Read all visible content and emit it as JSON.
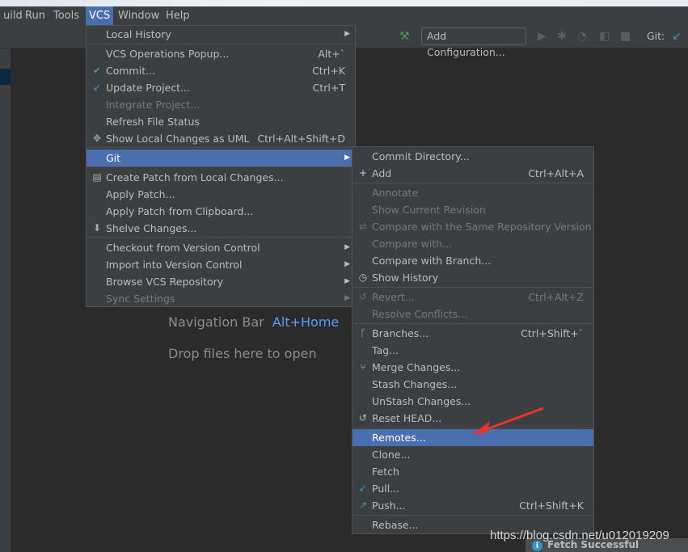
{
  "menubar": {
    "items": [
      "uild",
      "Run",
      "Tools",
      "VCS",
      "Window",
      "Help"
    ],
    "active": "VCS"
  },
  "toolbar": {
    "add_configuration": "Add Configuration...",
    "git_label": "Git:"
  },
  "editor_hints": {
    "navigation_bar": "Navigation Bar",
    "navigation_shortcut": "Alt+Home",
    "drop_files": "Drop files here to open"
  },
  "vcs_menu": [
    {
      "label": "Local History",
      "submenu": true
    },
    {
      "label": "VCS Operations Popup...",
      "shortcut": "Alt+`"
    },
    {
      "label": "Commit...",
      "shortcut": "Ctrl+K",
      "icon": "check-icon"
    },
    {
      "label": "Update Project...",
      "shortcut": "Ctrl+T",
      "icon": "update-arrow-icon"
    },
    {
      "label": "Integrate Project...",
      "disabled": true
    },
    {
      "label": "Refresh File Status"
    },
    {
      "label": "Show Local Changes as UML",
      "shortcut": "Ctrl+Alt+Shift+D",
      "icon": "uml-icon"
    },
    {
      "label": "Git",
      "submenu": true,
      "selected": true
    },
    {
      "label": "Create Patch from Local Changes...",
      "icon": "patch-icon"
    },
    {
      "label": "Apply Patch..."
    },
    {
      "label": "Apply Patch from Clipboard..."
    },
    {
      "label": "Shelve Changes...",
      "icon": "shelve-icon"
    },
    {
      "label": "Checkout from Version Control",
      "submenu": true
    },
    {
      "label": "Import into Version Control",
      "submenu": true
    },
    {
      "label": "Browse VCS Repository",
      "submenu": true
    },
    {
      "label": "Sync Settings",
      "submenu": true,
      "disabled": true
    }
  ],
  "git_menu": [
    {
      "label": "Commit Directory..."
    },
    {
      "label": "Add",
      "shortcut": "Ctrl+Alt+A",
      "icon": "plus-icon"
    },
    {
      "label": "Annotate",
      "disabled": true
    },
    {
      "label": "Show Current Revision",
      "disabled": true
    },
    {
      "label": "Compare with the Same Repository Version",
      "disabled": true,
      "icon": "compare-icon"
    },
    {
      "label": "Compare with...",
      "disabled": true
    },
    {
      "label": "Compare with Branch..."
    },
    {
      "label": "Show History",
      "icon": "clock-icon"
    },
    {
      "label": "Revert...",
      "shortcut": "Ctrl+Alt+Z",
      "disabled": true,
      "icon": "revert-icon"
    },
    {
      "label": "Resolve Conflicts...",
      "disabled": true
    },
    {
      "label": "Branches...",
      "shortcut": "Ctrl+Shift+`",
      "icon": "branch-icon"
    },
    {
      "label": "Tag..."
    },
    {
      "label": "Merge Changes...",
      "icon": "merge-icon"
    },
    {
      "label": "Stash Changes..."
    },
    {
      "label": "UnStash Changes..."
    },
    {
      "label": "Reset HEAD...",
      "icon": "reset-icon"
    },
    {
      "label": "Remotes...",
      "selected": true
    },
    {
      "label": "Clone..."
    },
    {
      "label": "Fetch"
    },
    {
      "label": "Pull...",
      "icon": "pull-icon"
    },
    {
      "label": "Push...",
      "shortcut": "Ctrl+Shift+K",
      "icon": "push-icon"
    },
    {
      "label": "Rebase..."
    }
  ],
  "status": {
    "notification": "Fetch Successful"
  },
  "watermark": "https://blog.csdn.net/u012019209",
  "colors": {
    "selection": "#4b6eaf",
    "menu_bg": "#3c3f41",
    "editor_bg": "#2b2b2b",
    "arrow_annotation": "#e8322a"
  }
}
